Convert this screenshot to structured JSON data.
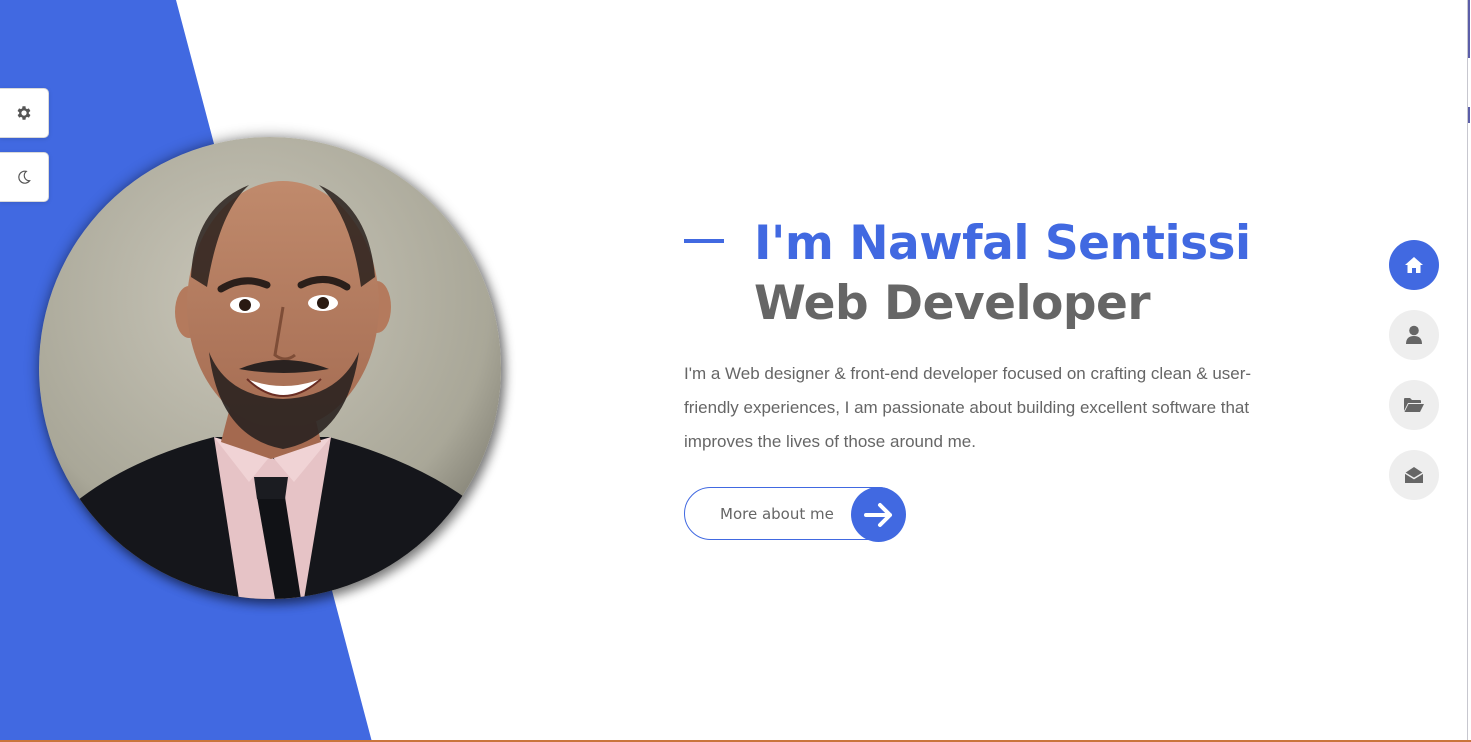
{
  "theme": {
    "accent": "#4169e1",
    "text_gray": "#666666",
    "nav_gray": "#eeeeee",
    "background": "#ffffff"
  },
  "side_controls": [
    {
      "icon": "gear-icon"
    },
    {
      "icon": "moon-icon"
    }
  ],
  "hero": {
    "name": "I'm Nawfal Sentissi",
    "role": "Web Developer",
    "description": "I'm a Web designer & front-end developer focused on crafting clean & user-friendly experiences, I am passionate about building excellent software that improves the lives of those around me.",
    "cta_label": "More about me",
    "cta_icon": "arrow-right-icon"
  },
  "profile_photo": {
    "shape": "circle"
  },
  "nav": [
    {
      "icon": "home-icon",
      "active": true
    },
    {
      "icon": "user-icon",
      "active": false
    },
    {
      "icon": "folder-open-icon",
      "active": false
    },
    {
      "icon": "envelope-open-icon",
      "active": false
    }
  ]
}
